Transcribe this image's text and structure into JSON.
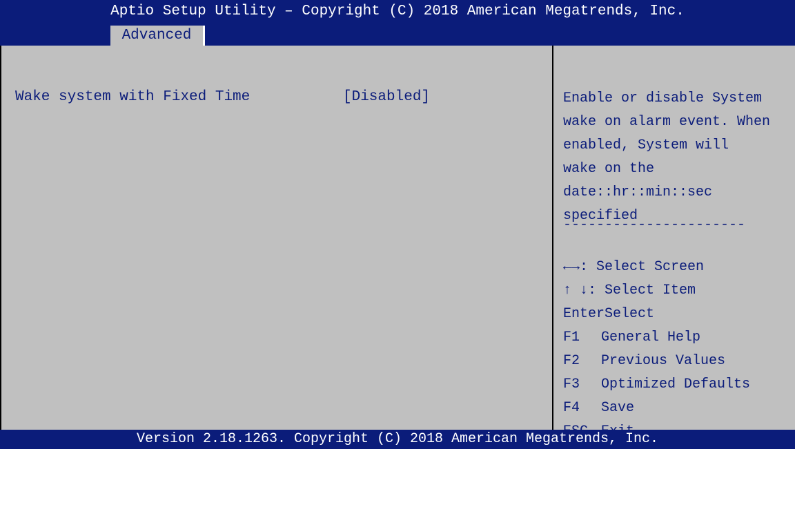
{
  "title": "Aptio Setup Utility – Copyright (C) 2018 American Megatrends, Inc.",
  "tabs": [
    {
      "label": "Advanced",
      "active": true
    }
  ],
  "settings": [
    {
      "label": "Wake system with Fixed Time",
      "value": "[Disabled]"
    }
  ],
  "help": {
    "lines": [
      "Enable or disable System",
      "wake on alarm event. When",
      "enabled, System will",
      "wake on the",
      "date::hr::min::sec",
      "specified"
    ],
    "separator": "----------------------",
    "keys": [
      {
        "key": "",
        "desc": "←→: Select Screen"
      },
      {
        "key": "",
        "desc": "↑ ↓: Select Item"
      },
      {
        "key": "EnterSelect",
        "desc": ""
      },
      {
        "key": "F1",
        "desc": "General Help"
      },
      {
        "key": "F2",
        "desc": "Previous Values"
      },
      {
        "key": "F3",
        "desc": "Optimized Defaults"
      },
      {
        "key": "F4",
        "desc": "Save"
      },
      {
        "key": "ESC",
        "desc": "Exit"
      }
    ]
  },
  "footer": "Version 2.18.1263. Copyright (C) 2018 American Megatrends, Inc.",
  "colors": {
    "bar": "#0b1c7a",
    "panel": "#c0c0c0",
    "text": "#0b1c7a"
  }
}
